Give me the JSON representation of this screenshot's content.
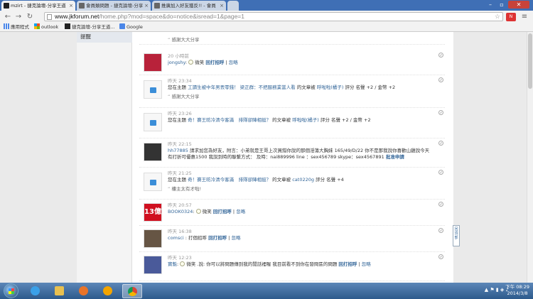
{
  "browser": {
    "tabs": [
      {
        "title": "mzirt - 捷克論壇-分享王道"
      },
      {
        "title": "會員類問題 - 捷克論壇-分享"
      },
      {
        "title": "推廣加入好友獲反!! - 會員"
      }
    ],
    "address": {
      "host": "www.jkforum.net",
      "path": "/home.php?mod=space&do=notice&isread=1&page=1"
    },
    "bookmarks": [
      {
        "label": "應用程式"
      },
      {
        "label": "outlook"
      },
      {
        "label": "捷克論壇-分享王道..."
      },
      {
        "label": "Google"
      }
    ]
  },
  "sidebar": {
    "nav_label": "提醒"
  },
  "top_partial_quote": "感謝大大分享",
  "notices": [
    {
      "time": "20 小時前",
      "user": "jongshy",
      "suffix": ":",
      "emote": "微笑",
      "reply": "回打招呼",
      "sep": "|",
      "ignore": "忽略"
    },
    {
      "time": "昨天 23:34",
      "prefix": "您在主題",
      "topic": "工讀生被中年男丟零錢！",
      "rater": "梁正群：不把服務業當人看",
      "mid": "的文章被",
      "by": "呼啦啦(橘子)",
      "after": "評分 名聲 +2 / 金幣 +2",
      "quote": "感謝大大分享"
    },
    {
      "time": "昨天 23:26",
      "prefix": "您在主題",
      "topic": "奇！賽王昉冷清今客滿　排隊卻陣相挺？",
      "mid": "的文章被",
      "by": "呼啦啦(橘子)",
      "after": "評分 名聲 +2 / 金幣 +2"
    },
    {
      "time": "昨天 22:15",
      "user": "hh77885",
      "text1": "請求加您為好友，附言：小弟就是王哥上次買錯你說的那個淫蕩大胸妹 165/49/D/22 你不是那我說你喜歡山雞說今天",
      "text2": "有打折可優惠1500 我說到時的聯繫方式：",
      "text2b": "及時：nai889996 line ：sex456789 skype：sex4567891",
      "approve": "批准申請"
    },
    {
      "time": "昨天 21:25",
      "prefix": "您在主題",
      "topic": "奇！賽王昉冷清今客滿　排隊卻陣相挺？",
      "mid": "的文章被",
      "by": "cat0220g",
      "after": "評分 名聲 +4",
      "quote": "樓主太有才啦!"
    },
    {
      "time": "昨天 20:57",
      "user": "BOOK0324",
      "suffix": ":",
      "emote": "微笑",
      "reply": "回打招呼",
      "sep": "|",
      "ignore": "忽略",
      "avatar_text": "13億"
    },
    {
      "time": "昨天 16:38",
      "user": "comsci",
      "suffix": ": 打個招呼",
      "reply": "回打招呼",
      "sep": "|",
      "ignore": "忽略"
    },
    {
      "time": "昨天 12:23",
      "user": "寶魁",
      "suffix": ":",
      "emote": "微笑 .說: 你可以將問題傳到我的閒話裡喔 我目前看不到你在發問區的問題",
      "reply": "回打招呼",
      "sep": "|",
      "ignore": "忽略"
    }
  ],
  "float_tab": "回頂部",
  "taskbar": {
    "clock_time": "下午 08:29",
    "clock_date": "2014/3/8"
  }
}
